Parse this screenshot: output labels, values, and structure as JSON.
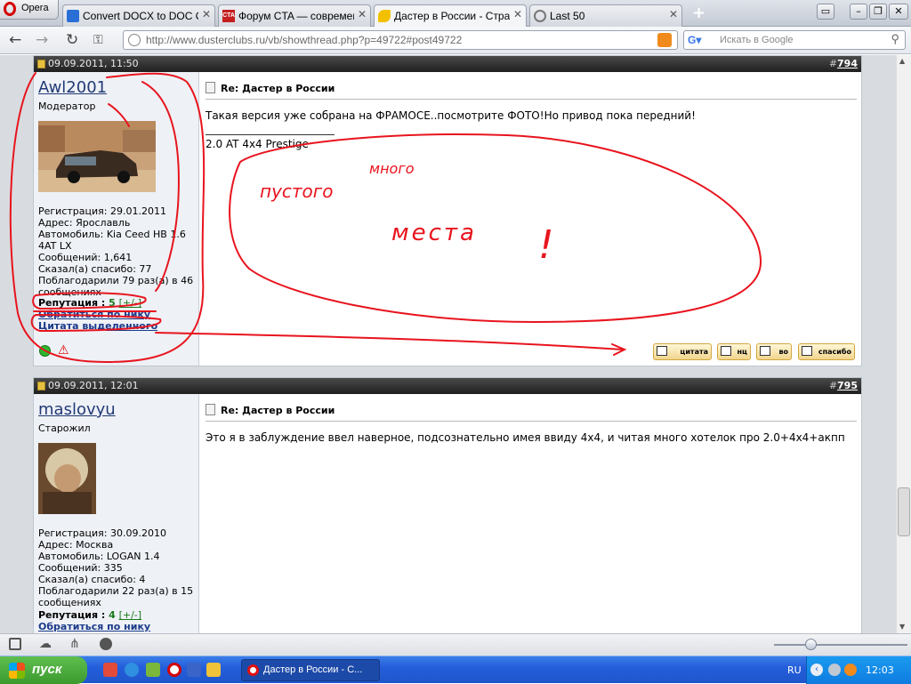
{
  "browser": {
    "menu_label": "Opera",
    "tabs": [
      {
        "title": "Convert DOCX to DOC O..."
      },
      {
        "title": "Форум CTA — современ..."
      },
      {
        "title": "Дастер в России - Стра..."
      },
      {
        "title": "Last 50"
      }
    ],
    "url": "http://www.dusterclubs.ru/vb/showthread.php?p=49722#post49722",
    "search_placeholder": "Искать в Google"
  },
  "posts": [
    {
      "date": "09.09.2011, 11:50",
      "number_prefix": "#",
      "number": "794",
      "username": "Awl2001",
      "user_title": "Модератор",
      "info": [
        "Регистрация: 29.01.2011",
        "Адрес: Ярославль",
        "Автомобиль: Kia Ceed HB 1.6 4AT LX",
        "Сообщений: 1,641",
        "Сказал(а) спасибо: 77",
        "Поблагодарили 79 раз(а) в 46 сообщениях"
      ],
      "reputation_label": "Репутация",
      "reputation_value": "5",
      "reputation_link": "[+/-]",
      "link_nick": "Обратиться по нику",
      "link_quote": "Цитата выделенного",
      "title": "Re: Дастер в России",
      "text": "Такая версия уже собрана на ФРАМОСЕ..посмотрите ФОТО!Но привод пока передний!",
      "signature": "2.0 AT 4x4 Prestige",
      "buttons": [
        "цитата",
        "нц",
        "во",
        "спасибо"
      ]
    },
    {
      "date": "09.09.2011, 12:01",
      "number_prefix": "#",
      "number": "795",
      "username": "maslovyu",
      "user_title": "Старожил",
      "info": [
        "Регистрация: 30.09.2010",
        "Адрес: Москва",
        "Автомобиль: LOGAN 1.4",
        "Сообщений: 335",
        "Сказал(а) спасибо: 4",
        "Поблагодарили 22 раз(а) в 15 сообщениях"
      ],
      "reputation_label": "Репутация",
      "reputation_value": "4",
      "reputation_link": "[+/-]",
      "link_nick": "Обратиться по нику",
      "title": "Re: Дастер в России",
      "text": "Это я в заблуждение ввел наверное, подсознательно имея ввиду 4x4, и читая много хотелок про 2.0+4x4+акпп"
    }
  ],
  "annotation": {
    "line1": "много",
    "line2": "пустого",
    "line3": "места",
    "mark": "!",
    "color": "#e8141e"
  },
  "taskbar": {
    "start_label": "пуск",
    "task_label": "Дастер в России - С...",
    "language": "RU",
    "clock": "12:03"
  }
}
